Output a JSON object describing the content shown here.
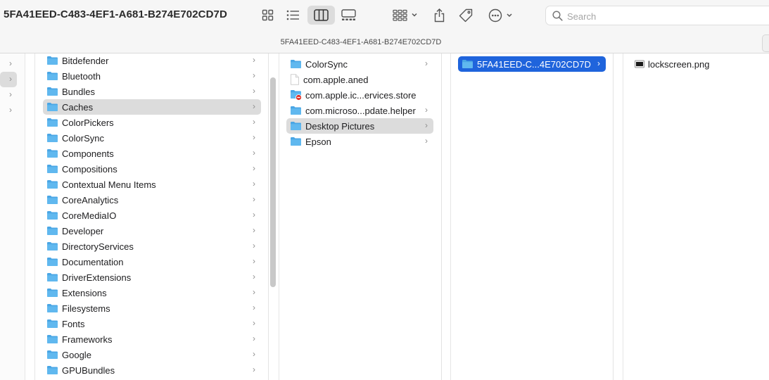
{
  "window": {
    "title": "5FA41EED-C483-4EF1-A681-B274E702CD7D",
    "path_title": "5FA41EED-C483-4EF1-A681-B274E702CD7D"
  },
  "toolbar": {
    "view_icons": "view-as-icons-icon",
    "view_list": "view-as-list-icon",
    "view_columns": "view-as-columns-icon",
    "view_gallery": "view-as-gallery-icon",
    "group": "group-by-icon",
    "share": "share-icon",
    "tags": "tag-icon",
    "more": "more-actions-icon",
    "active_view": "columns"
  },
  "search": {
    "placeholder": "Search",
    "value": ""
  },
  "sidebar_col": {
    "rows": 4,
    "selected_index": 1
  },
  "col_library": {
    "items": [
      {
        "label": "Bitdefender"
      },
      {
        "label": "Bluetooth"
      },
      {
        "label": "Bundles"
      },
      {
        "label": "Caches",
        "selected": true
      },
      {
        "label": "ColorPickers"
      },
      {
        "label": "ColorSync"
      },
      {
        "label": "Components"
      },
      {
        "label": "Compositions"
      },
      {
        "label": "Contextual Menu Items"
      },
      {
        "label": "CoreAnalytics"
      },
      {
        "label": "CoreMediaIO"
      },
      {
        "label": "Developer"
      },
      {
        "label": "DirectoryServices"
      },
      {
        "label": "Documentation"
      },
      {
        "label": "DriverExtensions"
      },
      {
        "label": "Extensions"
      },
      {
        "label": "Filesystems"
      },
      {
        "label": "Fonts"
      },
      {
        "label": "Frameworks"
      },
      {
        "label": "Google"
      },
      {
        "label": "GPUBundles"
      }
    ]
  },
  "col_caches": {
    "items": [
      {
        "label": "ColorSync",
        "kind": "folder",
        "arrow": true
      },
      {
        "label": "com.apple.aned",
        "kind": "file",
        "arrow": false
      },
      {
        "label": "com.apple.ic...ervices.store",
        "kind": "restricted-folder",
        "arrow": false
      },
      {
        "label": "com.microso...pdate.helper",
        "kind": "folder",
        "arrow": true
      },
      {
        "label": "Desktop Pictures",
        "kind": "folder",
        "arrow": true,
        "selected": true
      },
      {
        "label": "Epson",
        "kind": "folder",
        "arrow": true
      }
    ]
  },
  "col_desktop_pictures": {
    "items": [
      {
        "label": "5FA41EED-C...4E702CD7D",
        "kind": "folder",
        "arrow": true,
        "selected": true
      }
    ]
  },
  "col_uuid": {
    "items": [
      {
        "label": "lockscreen.png",
        "kind": "image"
      }
    ]
  },
  "colors": {
    "folder": "#60b8ef",
    "folder_tab": "#4aa6e5",
    "selection_blue": "#1f64dc",
    "selection_gray": "#dcdcdc",
    "toolbar_bg": "#f6f6f6"
  }
}
